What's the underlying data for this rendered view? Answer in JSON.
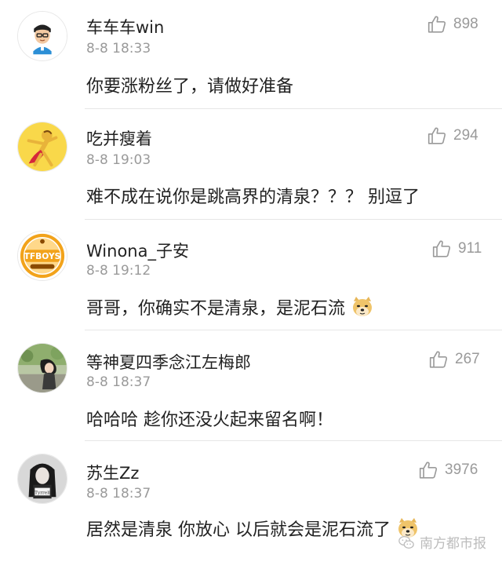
{
  "comments": [
    {
      "username": "车车车win",
      "timestamp": "8-8 18:33",
      "text": "你要涨粉丝了，请做好准备",
      "likes": "898",
      "avatar": "cartoon-boy-avatar"
    },
    {
      "username": "吃并瘦着",
      "timestamp": "8-8 19:03",
      "text": "难不成在说你是跳高界的清泉？？？ 别逗了",
      "likes": "294",
      "avatar": "cartoon-dancer-avatar"
    },
    {
      "username": "Winona_子安",
      "timestamp": "8-8 19:12",
      "text": "哥哥，你确实不是清泉，是泥石流",
      "likes": "911",
      "avatar": "tfboys-badge-avatar",
      "emoji": "doge-emoji"
    },
    {
      "username": "等神夏四季念江左梅郎",
      "timestamp": "8-8 18:37",
      "text": "哈哈哈 趁你还没火起来留名啊！",
      "likes": "267",
      "avatar": "photo-girl-avatar"
    },
    {
      "username": "苏生Zz",
      "timestamp": "8-8 18:37",
      "text": "居然是清泉 你放心 以后就会是泥石流了",
      "likes": "3976",
      "avatar": "photo-girl-bw-avatar",
      "emoji": "doge-emoji"
    }
  ],
  "watermark": "南方都市报",
  "icons": {
    "like": "thumbs-up-icon",
    "watermark": "wechat-icon"
  },
  "colors": {
    "text": "#222222",
    "meta": "#9a9a9a",
    "divider": "#e6e6e6"
  }
}
